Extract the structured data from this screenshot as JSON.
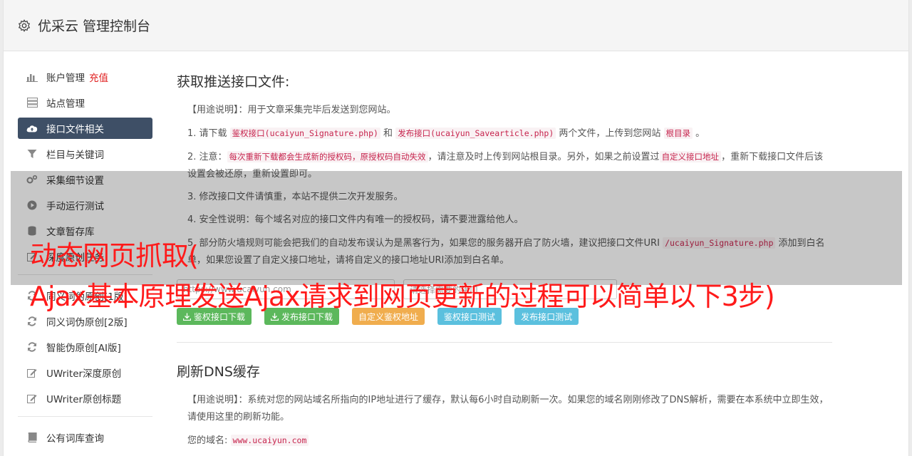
{
  "app": {
    "title": "优采云 管理控制台"
  },
  "sidebar": {
    "items": [
      {
        "label": "账户管理",
        "badge": "充值",
        "icon": "bar-chart-icon"
      },
      {
        "label": "站点管理",
        "icon": "server-icon"
      },
      {
        "label": "接口文件相关",
        "icon": "cloud-upload-icon",
        "active": true
      },
      {
        "label": "栏目与关键词",
        "icon": "filter-icon"
      },
      {
        "label": "采集细节设置",
        "icon": "cogs-icon"
      },
      {
        "label": "手动运行测试",
        "icon": "play-icon"
      },
      {
        "label": "文章暂存库",
        "icon": "database-icon"
      },
      {
        "label": "深度原创任务",
        "icon": "edit-icon"
      }
    ],
    "items2": [
      {
        "label": "同义词伪原创[1版]",
        "icon": "refresh-icon"
      },
      {
        "label": "同义词伪原创[2版]",
        "icon": "refresh-icon"
      },
      {
        "label": "智能伪原创[AI版]",
        "icon": "refresh-icon"
      },
      {
        "label": "UWriter深度原创",
        "icon": "edit-icon"
      },
      {
        "label": "UWriter原创标题",
        "icon": "edit-icon"
      }
    ],
    "items3": [
      {
        "label": "公有词库查询",
        "icon": "book-icon"
      }
    ]
  },
  "main": {
    "section1": {
      "title": "获取推送接口文件:",
      "usage_label": "【用途说明】",
      "usage_text": "：用于文章采集完毕后发送到您网站。",
      "p1_a": "1. 请下载 ",
      "p1_code1": "鉴权接口(ucaiyun_Signature.php)",
      "p1_b": " 和 ",
      "p1_code2": "发布接口(ucaiyun_Savearticle.php)",
      "p1_c": " 两个文件，上传到您网站 ",
      "p1_code3": "根目录",
      "p1_d": " 。",
      "p2_a": "2. 注意：",
      "p2_code1": "每次重新下载都会生成新的授权码，原授权码自动失效",
      "p2_b": "，请注意及时上传到网站根目录。另外，如果之前设置过",
      "p2_code2": "自定义接口地址",
      "p2_c": "，重新下载接口文件后该设置会被还原，重新设置即可。",
      "p3": "3. 修改接口文件请慎重，本站不提供二次开发服务。",
      "p4": "4. 安全性说明：每个域名对应的接口文件内有唯一的授权码，请不要泄露给他人。",
      "p5_a": "5. 部分防火墙规则可能会把我们的自动发布误认为是黑客行为，如果您的服务器开启了防火墙，建议把接口文件URI ",
      "p5_code": "/ucaiyun_Signature.php",
      "p5_b": " 添加到白名单，如果您设置了自定义接口地址，请将自定义的接口地址URI添加到白名单。",
      "input1_placeholder": "https://www.ucaiyun.com",
      "input2_placeholder": "请选择需要的接口",
      "buttons": {
        "auth_download": "鉴权接口下载",
        "publish_download": "发布接口下载",
        "custom_auth": "自定义鉴权地址",
        "auth_test": "鉴权接口测试",
        "publish_test": "发布接口测试"
      }
    },
    "section2": {
      "title": "刷新DNS缓存",
      "usage_label": "【用途说明】",
      "usage_text": "：系统对您的网站域名所指向的IP地址进行了缓存，默认每6小时自动刷新一次。如果您的域名刚刚修改了DNS解析，需要在本系统中立即生效，请使用这里的刷新功能。",
      "domain_label": "您的域名: ",
      "domain_value": "www.ucaiyun.com"
    }
  },
  "overlay": {
    "line1": "动态网页抓取(",
    "line2": "Ajax基本原理发送Ajax请求到网页更新的过程可以简单以下3步)"
  },
  "colors": {
    "active_bg": "#3e4f66",
    "green": "#5cb85c",
    "orange": "#f0ad4e",
    "blue": "#5bc0de",
    "caption": "#ff1a1a"
  }
}
